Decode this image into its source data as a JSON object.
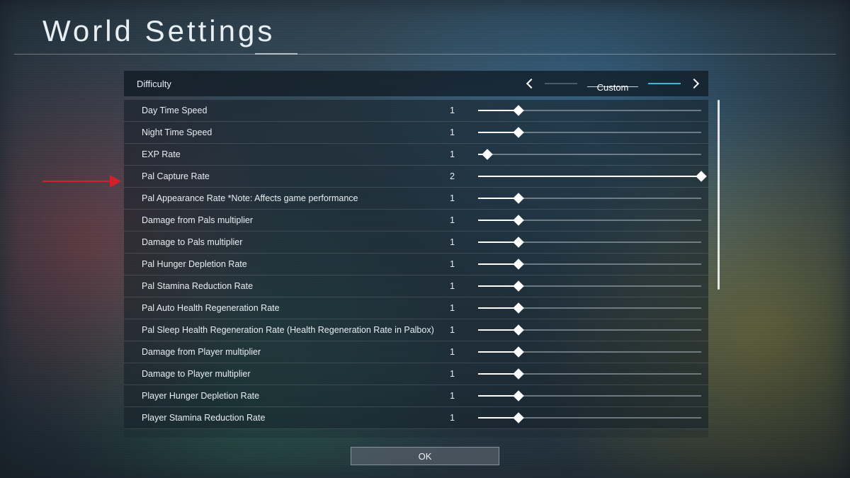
{
  "title": "World Settings",
  "header": {
    "label": "Difficulty",
    "value": "Custom"
  },
  "slider_min": 0.1,
  "slider_max": 2,
  "settings": [
    {
      "label": "Day Time Speed",
      "value": 1,
      "fill": 18
    },
    {
      "label": "Night Time Speed",
      "value": 1,
      "fill": 18
    },
    {
      "label": "EXP Rate",
      "value": 1,
      "fill": 4
    },
    {
      "label": "Pal Capture Rate",
      "value": 2,
      "fill": 100
    },
    {
      "label": "Pal Appearance Rate *Note: Affects game performance",
      "value": 1,
      "fill": 18
    },
    {
      "label": "Damage from Pals multiplier",
      "value": 1,
      "fill": 18
    },
    {
      "label": "Damage to Pals multiplier",
      "value": 1,
      "fill": 18
    },
    {
      "label": "Pal Hunger Depletion Rate",
      "value": 1,
      "fill": 18
    },
    {
      "label": "Pal Stamina Reduction Rate",
      "value": 1,
      "fill": 18
    },
    {
      "label": "Pal Auto Health Regeneration Rate",
      "value": 1,
      "fill": 18
    },
    {
      "label": "Pal Sleep Health Regeneration Rate (Health Regeneration Rate in Palbox)",
      "value": 1,
      "fill": 18
    },
    {
      "label": "Damage from Player multiplier",
      "value": 1,
      "fill": 18
    },
    {
      "label": "Damage to Player multiplier",
      "value": 1,
      "fill": 18
    },
    {
      "label": "Player Hunger Depletion Rate",
      "value": 1,
      "fill": 18
    },
    {
      "label": "Player Stamina Reduction Rate",
      "value": 1,
      "fill": 18
    }
  ],
  "ok_label": "OK"
}
